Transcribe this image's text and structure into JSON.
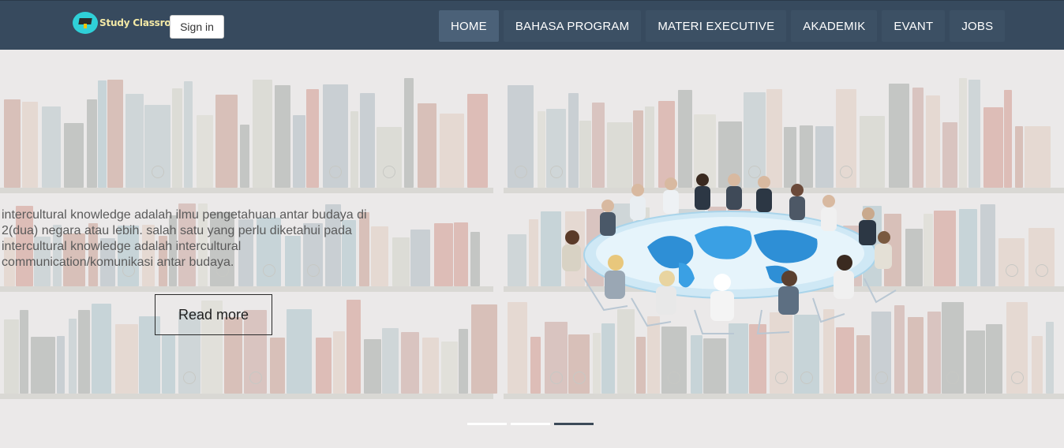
{
  "brand": {
    "name": "Study Classroom",
    "logo_icon": "graduation-cap-icon"
  },
  "header": {
    "signin_label": "Sign in"
  },
  "nav": {
    "items": [
      {
        "label": "HOME",
        "active": true
      },
      {
        "label": "BAHASA PROGRAM",
        "active": false
      },
      {
        "label": "MATERI EXECUTIVE",
        "active": false
      },
      {
        "label": "AKADEMIK",
        "active": false
      },
      {
        "label": "EVANT",
        "active": false
      },
      {
        "label": "JOBS",
        "active": false
      }
    ]
  },
  "slide": {
    "caption_lines": [
      "intercultural knowledge adalah ilmu pengetahuan antar budaya di",
      "2(dua) negara atau lebih. salah satu yang perlu diketahui pada",
      "intercultural knowledge adalah intercultural",
      "communication/komunikasi antar budaya."
    ],
    "button_label": "Read more",
    "image": "intercultural-meeting-image"
  },
  "carousel": {
    "slide_count": 3,
    "active_index": 2
  },
  "colors": {
    "navbar": "#374a5e",
    "nav_active": "#4b6178",
    "background": "#ebe9e9",
    "indicator_active": "#3b4a58",
    "logo_text": "#f3e9a6",
    "logo_badge": "#2fd0d8"
  }
}
